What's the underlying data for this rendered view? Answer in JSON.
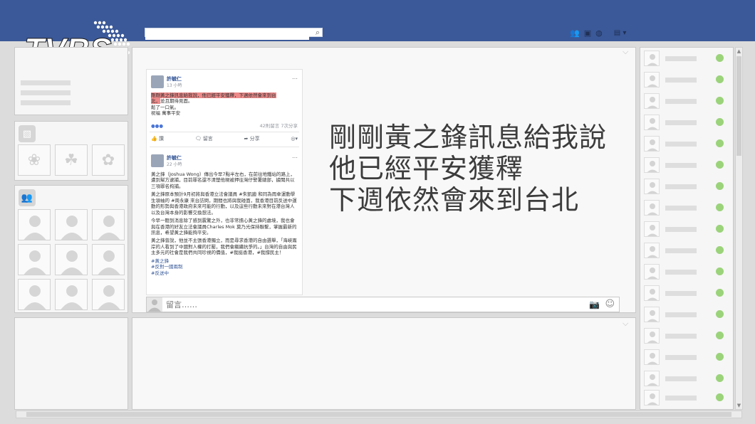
{
  "logo": {
    "text": "TVBS NEWS"
  },
  "search": {
    "placeholder": ""
  },
  "post": {
    "author": "許毓仁",
    "time": "13 小時",
    "highlight_line1": "剛剛黃之鋒訊息給我說，他已經平安獲釋，下週依然會來到台",
    "highlight_line2": "北，",
    "tail_line2": "並且期待見面。",
    "line3": "鬆了一口氣。",
    "line4": "祝福 萬事平安",
    "stats": "42則留言 7次分享",
    "actions": [
      "讚",
      "留言",
      "分享"
    ]
  },
  "post2": {
    "author": "許毓仁",
    "time": "22 小時",
    "p1": "黃之鋒（Joshua Wong）傳出今早7點半左右，在前往地鐵站的路上，遭到幫方逮捕，目前罪名還不清楚他現被押往灣仔警署總部，據聞共以三項罪名拘捕。",
    "p2": "黃之鋒原本預計9月初將與香港立法會議員 #朱凱廸 和同為雨傘運動學生領袖的 #周永康 來台訪問，期間也將與我碰面，我香港目前反送中運動的形勢與香港政府未來可能的行動，以及這些行動未來對在港台灣人以及台灣本身的影響交換想法。",
    "p3": "今早一聽到消息除了感到震驚之外，也非常擔心黃之鋒的處境，我也會與在香港的好友立法會議員Charles Mok 莫乃光保持聯繫，掌握最新的訊息，希望黃之鋒能夠平安。",
    "p4": "黃之鋒曾說，他並不主張香港獨立，而是尋求香港的自由選舉，「海峽兩岸的人看到了中國對人權的打壓，我們會繼續抗爭的。」台灣的自由與民主多元的社會是我們共同珍視的價值，#我挺香港，#我撐民主！",
    "tags": [
      "#黃之鋒",
      "#反對一國兩制",
      "#反送中"
    ]
  },
  "quote": {
    "line1": "剛剛黃之鋒訊息給我說",
    "line2": "他已經平安獲釋",
    "line3": "下週依然會來到台北"
  },
  "comment": {
    "placeholder": "留言……"
  },
  "icons": {
    "search": "search-icon",
    "friends": "friends-icon",
    "messages": "messages-icon",
    "globe": "globe-icon",
    "camera": "camera-icon",
    "smile": "emoji-icon"
  }
}
